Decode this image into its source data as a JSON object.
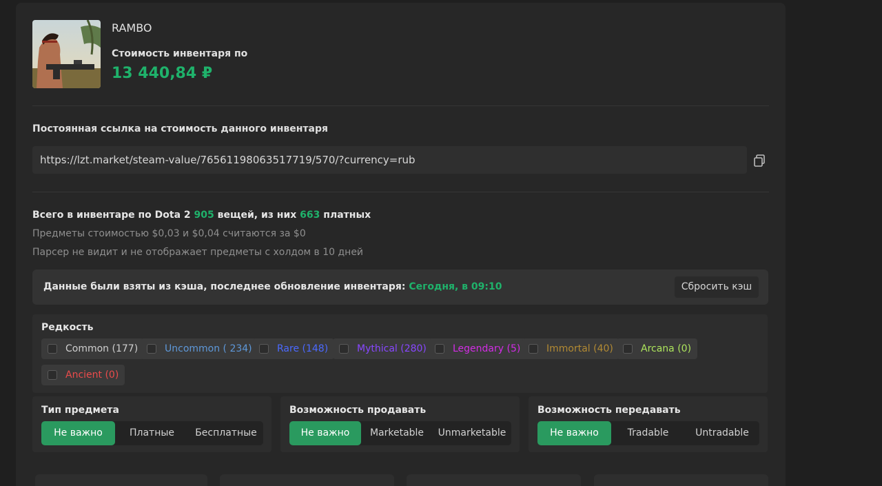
{
  "profile": {
    "username": "RAMBO",
    "inventory_label": "Стоимость инвентаря по",
    "inventory_value": "13 440,84 ₽"
  },
  "link": {
    "title": "Постоянная ссылка на стоимость данного инвентаря",
    "url": "https://lzt.market/steam-value/76561198063517719/570/?currency=rub"
  },
  "summary": {
    "prefix": "Всего в инвентаре по Dota 2",
    "total": "905",
    "middle": "вещей, из них",
    "paid": "663",
    "suffix": "платных",
    "note1": "Предметы стоимостью $0,03 и $0,04 считаются за $0",
    "note2": "Парсер не видит и не отображает предметы с холдом в 10 дней"
  },
  "cache": {
    "text": "Данные были взяты из кэша, последнее обновление инвентаря:",
    "time": "Сегодня, в 09:10",
    "reset_label": "Сбросить кэш"
  },
  "rarity": {
    "title": "Редкость",
    "items": [
      {
        "label": "Common (177)",
        "color": "#cfcfcf"
      },
      {
        "label": "Uncommon ( 234)",
        "color": "#5e98d9"
      },
      {
        "label": "Rare (148)",
        "color": "#4b69ff"
      },
      {
        "label": "Mythical (280)",
        "color": "#8847ff"
      },
      {
        "label": "Legendary (5)",
        "color": "#d32ce6"
      },
      {
        "label": "Immortal (40)",
        "color": "#b28a33"
      },
      {
        "label": "Arcana (0)",
        "color": "#ade55c"
      },
      {
        "label": "Ancient (0)",
        "color": "#eb4b4b"
      }
    ]
  },
  "filters": {
    "item_type": {
      "title": "Тип предмета",
      "options": [
        "Не важно",
        "Платные",
        "Бесплатные"
      ],
      "active": 0
    },
    "marketable": {
      "title": "Возможность продавать",
      "options": [
        "Не важно",
        "Marketable",
        "Unmarketable"
      ],
      "active": 0
    },
    "tradable": {
      "title": "Возможность передавать",
      "options": [
        "Не важно",
        "Tradable",
        "Untradable"
      ],
      "active": 0
    }
  },
  "colors": {
    "accent_green": "#1fb26b",
    "active_button": "#2a9a5f",
    "background": "#1f1f1f",
    "card": "#272727"
  }
}
